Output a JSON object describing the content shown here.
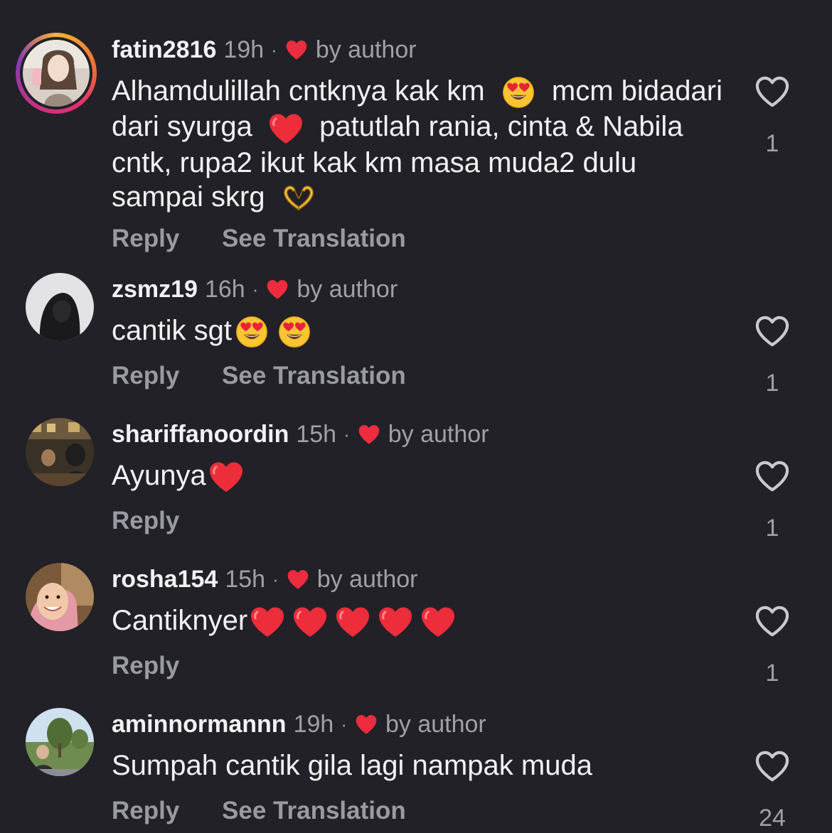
{
  "colors": {
    "background": "#212127",
    "text_primary": "#f2f2f5",
    "text_secondary": "#a0a0a8",
    "heart_red": "#ed2d3f"
  },
  "comments": [
    {
      "username": "fatin2816",
      "time": "19h",
      "separator": "·",
      "liked_by": "by author",
      "text_parts": [
        "Alhamdulillah cntknya kak km",
        "mcm bidadari dari syurga",
        "patutlah rania, cinta & Nabila cntk, rupa2 ikut kak km masa muda2 dulu sampai skrg"
      ],
      "emojis": [
        "heart-eyes-emoji",
        "red-heart-emoji",
        "heart-hands-emoji"
      ],
      "reply": "Reply",
      "translate": "See Translation",
      "likes": "1",
      "story_ring": true
    },
    {
      "username": "zsmz19",
      "time": "16h",
      "separator": "·",
      "liked_by": "by author",
      "text": "cantik sgt",
      "emojis": [
        "heart-eyes-emoji",
        "heart-eyes-emoji"
      ],
      "reply": "Reply",
      "translate": "See Translation",
      "likes": "1"
    },
    {
      "username": "shariffanoordin",
      "time": "15h",
      "separator": "·",
      "liked_by": "by author",
      "text": "Ayunya",
      "emojis": [
        "red-heart-emoji"
      ],
      "reply": "Reply",
      "likes": "1"
    },
    {
      "username": "rosha154",
      "time": "15h",
      "separator": "·",
      "liked_by": "by author",
      "text": "Cantiknyer",
      "emojis": [
        "red-heart-emoji",
        "red-heart-emoji",
        "red-heart-emoji",
        "red-heart-emoji",
        "red-heart-emoji"
      ],
      "reply": "Reply",
      "likes": "1"
    },
    {
      "username": "aminnormannn",
      "time": "19h",
      "separator": "·",
      "liked_by": "by author",
      "text": "Sumpah cantik gila lagi nampak muda",
      "reply": "Reply",
      "translate": "See Translation",
      "likes": "24"
    }
  ]
}
